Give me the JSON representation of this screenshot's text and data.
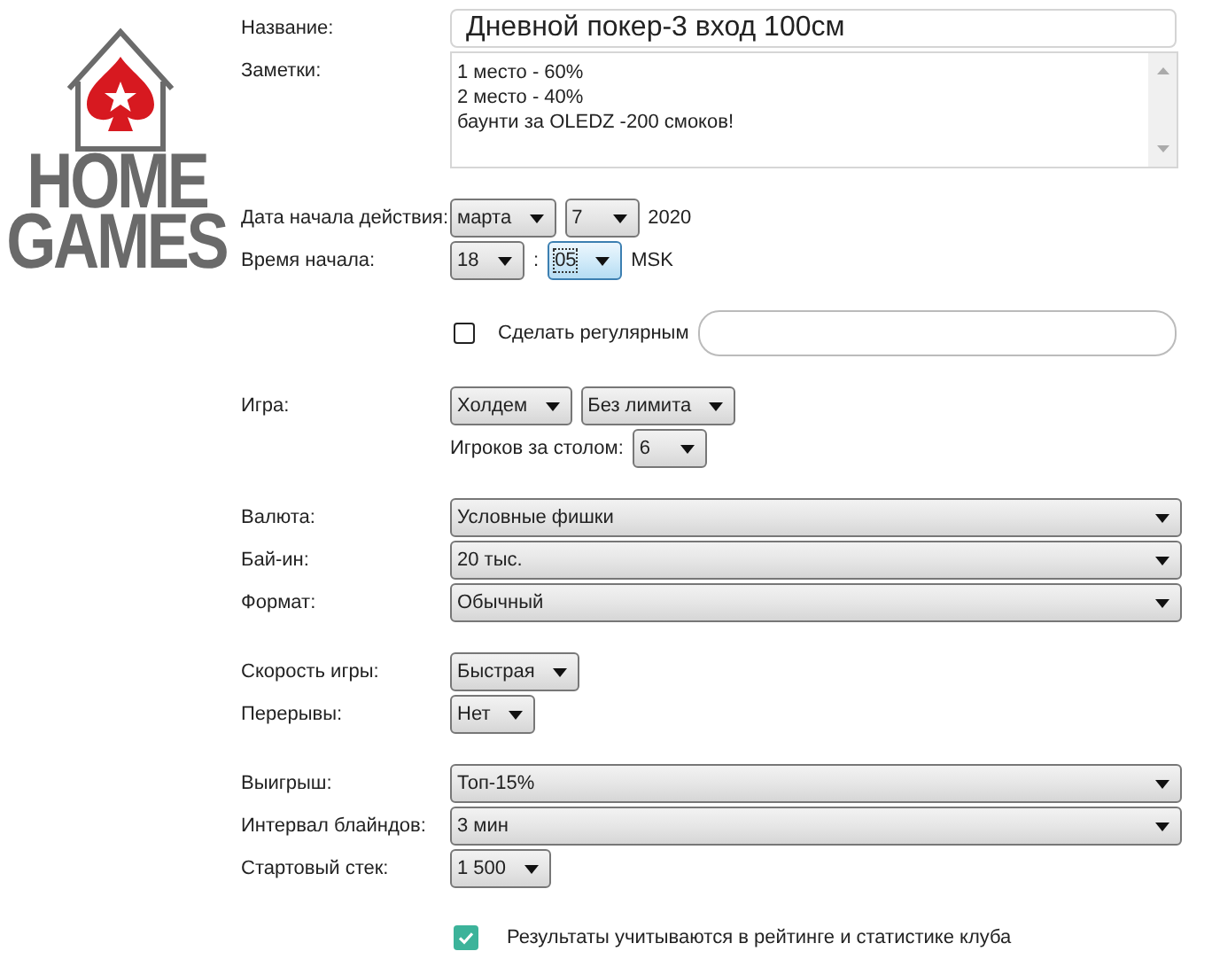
{
  "logo": {
    "line_1": "HOME",
    "line_2": "GAMES"
  },
  "sections": [
    {
      "rows": [
        {
          "label": "Название:",
          "controls": [
            {
              "kind": "input",
              "value": "Дневной покер-3 вход 100см"
            }
          ]
        },
        {
          "label": "Заметки:",
          "controls": [
            {
              "kind": "notes",
              "lines": [
                "1 место - 60%",
                "2 место - 40%",
                "баунти за OLEDZ -200 смоков!"
              ]
            }
          ]
        }
      ]
    },
    {
      "rows": [
        {
          "label": "Дата начала действия:",
          "controls": [
            {
              "kind": "select",
              "value": "марта",
              "focused": false,
              "full": false
            },
            {
              "kind": "select",
              "value": "7",
              "focused": false,
              "full": false
            },
            {
              "kind": "text",
              "value": "2020"
            }
          ]
        },
        {
          "label": "Время начала:",
          "controls": [
            {
              "kind": "select",
              "value": "18",
              "focused": false,
              "full": false
            },
            {
              "kind": "text",
              "value": ":"
            },
            {
              "kind": "select",
              "value": "05",
              "focused": true,
              "full": false
            },
            {
              "kind": "text",
              "value": "MSK"
            }
          ]
        }
      ]
    },
    {
      "rows": [
        {
          "controls": [
            {
              "kind": "checkbox",
              "checked": false,
              "value": "Сделать регулярным"
            },
            {
              "kind": "round-input"
            }
          ]
        }
      ]
    },
    {
      "rows": [
        {
          "label": "Игра:",
          "controls": [
            {
              "kind": "select",
              "value": "Холдем",
              "focused": false,
              "full": false
            },
            {
              "kind": "select",
              "value": "Без лимита",
              "focused": false,
              "full": false
            }
          ]
        },
        {
          "controls": [
            {
              "kind": "text",
              "value": "Игроков за столом:"
            },
            {
              "kind": "select",
              "value": "6",
              "focused": false,
              "full": false
            }
          ]
        }
      ]
    },
    {
      "rows": [
        {
          "label": "Валюта:",
          "controls": [
            {
              "kind": "select",
              "value": "Условные фишки",
              "focused": false,
              "full": true
            }
          ]
        },
        {
          "label": "Бай-ин:",
          "controls": [
            {
              "kind": "select",
              "value": "20 тыс.",
              "focused": false,
              "full": true
            }
          ]
        },
        {
          "label": "Формат:",
          "controls": [
            {
              "kind": "select",
              "value": "Обычный",
              "focused": false,
              "full": true
            }
          ]
        }
      ]
    },
    {
      "rows": [
        {
          "label": "Скорость игры:",
          "controls": [
            {
              "kind": "select",
              "value": "Быстрая",
              "focused": false,
              "full": false
            }
          ]
        },
        {
          "label": "Перерывы:",
          "controls": [
            {
              "kind": "select",
              "value": "Нет",
              "focused": false,
              "full": false
            }
          ]
        }
      ]
    },
    {
      "rows": [
        {
          "label": "Выигрыш:",
          "controls": [
            {
              "kind": "select",
              "value": "Топ-15%",
              "focused": false,
              "full": true
            }
          ]
        },
        {
          "label": "Интервал блайндов:",
          "controls": [
            {
              "kind": "select",
              "value": "3 мин",
              "focused": false,
              "full": true
            }
          ]
        },
        {
          "label": "Стартовый стек:",
          "controls": [
            {
              "kind": "select",
              "value": "1 500",
              "focused": false,
              "full": false
            }
          ]
        }
      ]
    },
    {
      "rows": [
        {
          "controls": [
            {
              "kind": "checkbox",
              "checked": true,
              "value": "Результаты учитываются в рейтинге и статистике клуба"
            }
          ]
        }
      ]
    }
  ]
}
